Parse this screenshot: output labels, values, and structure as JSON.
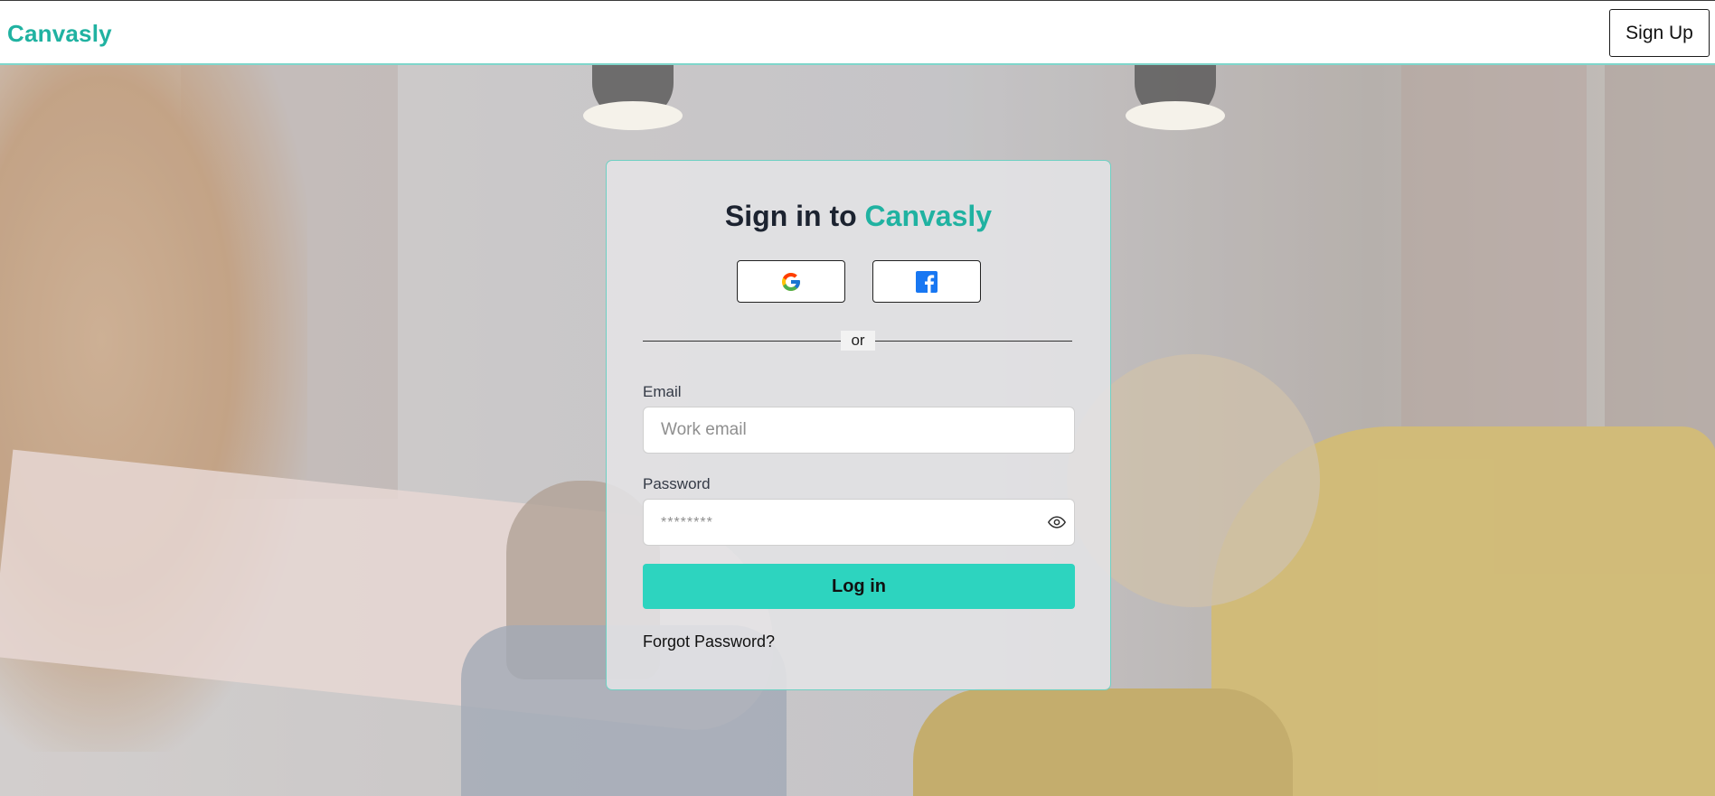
{
  "header": {
    "logo": "Canvasly",
    "signup_label": "Sign Up"
  },
  "login_card": {
    "title_prefix": "Sign in to",
    "title_brand": "Canvasly",
    "social": [
      {
        "provider": "Google",
        "icon": "google-icon"
      },
      {
        "provider": "Facebook",
        "icon": "facebook-icon"
      }
    ],
    "divider_text": "or",
    "email": {
      "label": "Email",
      "placeholder": "Work email",
      "value": ""
    },
    "password": {
      "label": "Password",
      "placeholder": "********",
      "value": "",
      "toggle_icon": "eye-icon"
    },
    "login_label": "Log in",
    "forgot_label": "Forgot Password?"
  },
  "colors": {
    "brand": "#20b2a1",
    "button_accent": "#2dd4bf",
    "card_border": "#6fd0c3"
  }
}
